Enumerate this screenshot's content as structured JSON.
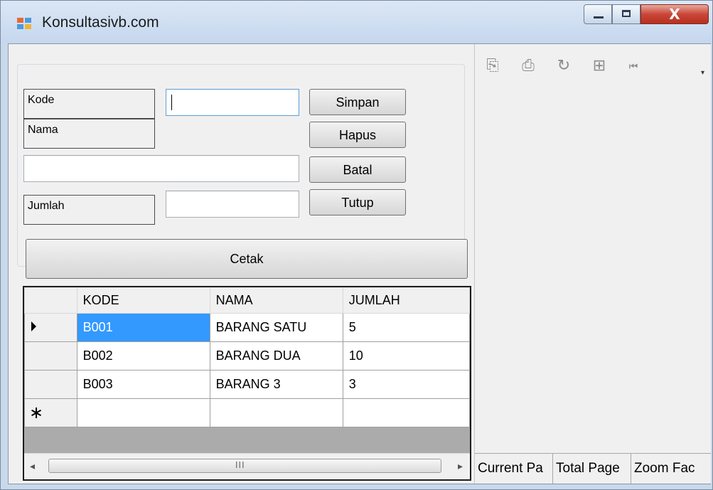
{
  "window": {
    "title": "Konsultasivb.com",
    "minimize_glyph": "",
    "maximize_glyph": "",
    "close_glyph": "X"
  },
  "form": {
    "kode_label": "Kode",
    "nama_label": "Nama",
    "jumlah_label": "Jumlah",
    "kode_value": "",
    "nama_value": "",
    "jumlah_value": ""
  },
  "buttons": {
    "simpan": "Simpan",
    "hapus": "Hapus",
    "batal": "Batal",
    "tutup": "Tutup",
    "cetak": "Cetak"
  },
  "grid": {
    "columns": [
      "KODE",
      "NAMA",
      "JUMLAH"
    ],
    "rows": [
      [
        "B001",
        "BARANG SATU",
        "5"
      ],
      [
        "B002",
        "BARANG DUA",
        "10"
      ],
      [
        "B003",
        "BARANG 3",
        "3"
      ]
    ],
    "new_row_marker": "∗",
    "scroll_grip": "III"
  },
  "report_viewer": {
    "toolbar_icons": [
      "export-icon",
      "print-icon",
      "refresh-icon",
      "group-tree-icon",
      "first-page-icon"
    ],
    "status": [
      "Current Pa",
      "Total Page",
      "Zoom Fac"
    ]
  },
  "colors": {
    "selection": "#3399ff",
    "close_button": "#c9473a"
  }
}
